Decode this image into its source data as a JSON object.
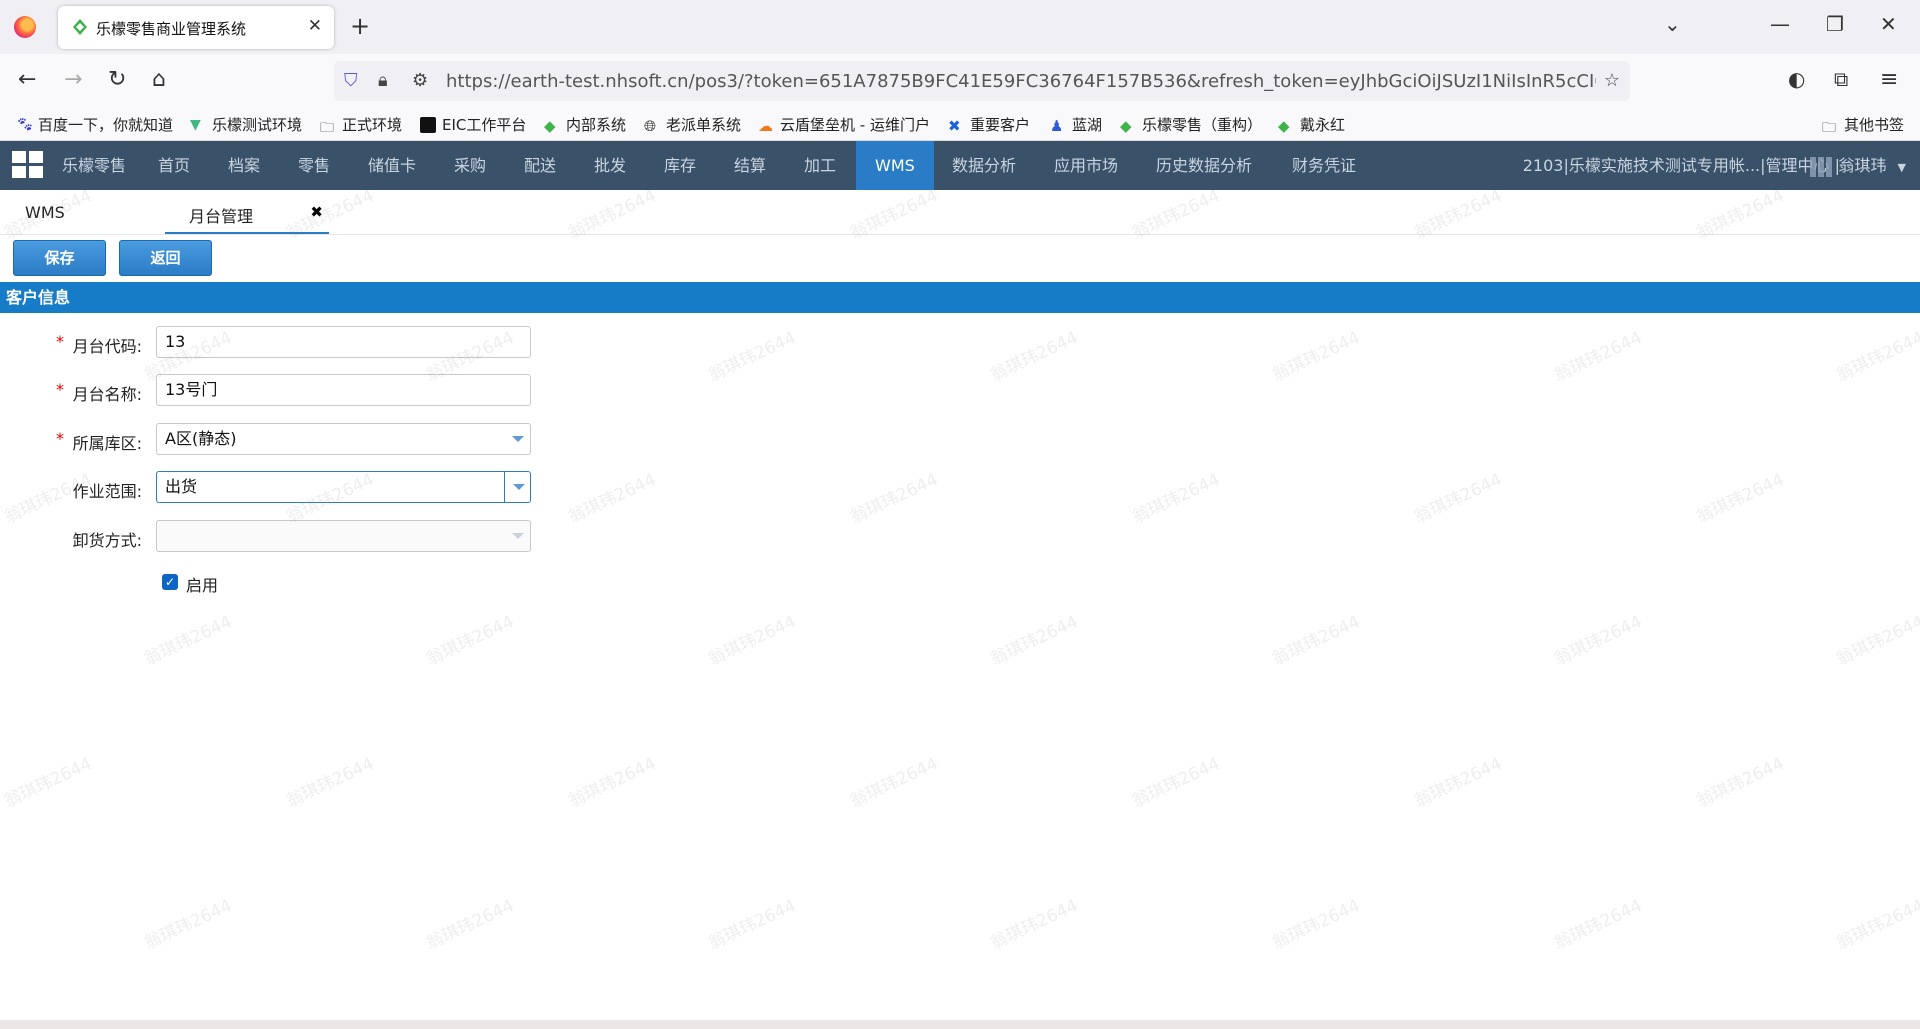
{
  "browser": {
    "tab_title": "乐檬零售商业管理系统",
    "url": "https://earth-test.nhsoft.cn/pos3/?token=651A7875B9FC41E59FC36764F157B536&refresh_token=eyJhbGciOiJSUzI1NiIsInR5cCI6IkpXVCJ9.",
    "bookmarks": [
      "百度一下，你就知道",
      "乐檬测试环境",
      "正式环境",
      "EIC工作平台",
      "内部系统",
      "老派单系统",
      "云盾堡垒机 - 运维门户",
      "重要客户",
      "蓝湖",
      "乐檬零售（重构）",
      "戴永红"
    ],
    "other_bookmarks": "其他书签"
  },
  "app": {
    "brand": "乐檬零售",
    "menu": [
      "首页",
      "档案",
      "零售",
      "储值卡",
      "采购",
      "配送",
      "批发",
      "库存",
      "结算",
      "加工",
      "WMS",
      "数据分析",
      "应用市场",
      "历史数据分析",
      "财务凭证"
    ],
    "active_menu": "WMS",
    "account": "2103|乐檬实施技术测试专用帐...|管理中心 |",
    "user": "翁琪玮"
  },
  "tabs": {
    "home": "WMS",
    "current": "月台管理"
  },
  "toolbar": {
    "save": "保存",
    "back": "返回"
  },
  "section_title": "客户信息",
  "form": {
    "code": {
      "label": "月台代码:",
      "value": "13",
      "required": true
    },
    "name": {
      "label": "月台名称:",
      "value": "13号门",
      "required": true
    },
    "zone": {
      "label": "所属库区:",
      "value": "A区(静态)",
      "required": true
    },
    "scope": {
      "label": "作业范围:",
      "value": "出货",
      "required": false
    },
    "unload": {
      "label": "卸货方式:",
      "value": "",
      "required": false
    },
    "enabled": {
      "label": "启用",
      "checked": true
    }
  },
  "watermark": "翁琪玮2644"
}
